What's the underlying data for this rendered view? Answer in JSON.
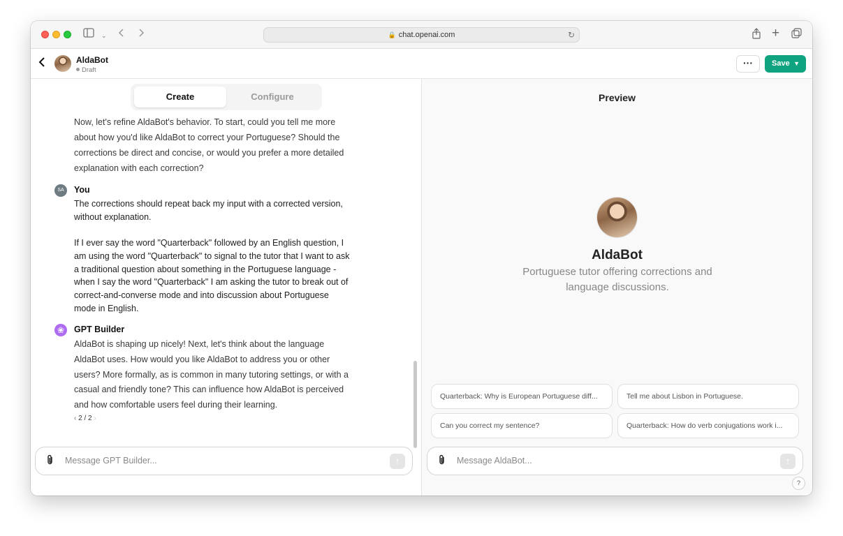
{
  "browser": {
    "url": "chat.openai.com"
  },
  "header": {
    "bot_name": "AldaBot",
    "status": "Draft",
    "more_label": "···",
    "save_label": "Save"
  },
  "tabs": {
    "create": "Create",
    "configure": "Configure"
  },
  "conversation": {
    "builder_msg_1": "Now, let's refine AldaBot's behavior. To start, could you tell me more about how you'd like AldaBot to correct your Portuguese? Should the corrections be direct and concise, or would you prefer a more detailed explanation with each correction?",
    "user_initials": "SA",
    "user_name": "You",
    "user_msg_p1": "The corrections should repeat back my input with a corrected version, without explanation.",
    "user_msg_p2": "If I ever say the word \"Quarterback\" followed by an English question, I am using the word \"Quarterback\" to signal to the tutor that I want to ask a traditional question about something in the Portuguese language - when I say the word \"Quarterback\" I am asking the tutor to break out of correct-and-converse mode and into discussion about Portuguese mode in English.",
    "builder_name": "GPT Builder",
    "builder_msg_2": "AldaBot is shaping up nicely! Next, let's think about the language AldaBot uses. How would you like AldaBot to address you or other users? More formally, as is common in many tutoring settings, or with a casual and friendly tone? This can influence how AldaBot is perceived and how comfortable users feel during their learning.",
    "pager": "2 / 2"
  },
  "left_composer": {
    "placeholder": "Message GPT Builder..."
  },
  "preview": {
    "title": "Preview",
    "bot_name": "AldaBot",
    "description": "Portuguese tutor offering corrections and language discussions.",
    "suggestions": [
      "Quarterback: Why is European Portuguese diff...",
      "Tell me about Lisbon in Portuguese.",
      "Can you correct my sentence?",
      "Quarterback: How do verb conjugations work i..."
    ],
    "placeholder": "Message AldaBot...",
    "help": "?"
  },
  "colors": {
    "accent": "#10a37f",
    "builder_avatar": "#ad6cf2"
  }
}
